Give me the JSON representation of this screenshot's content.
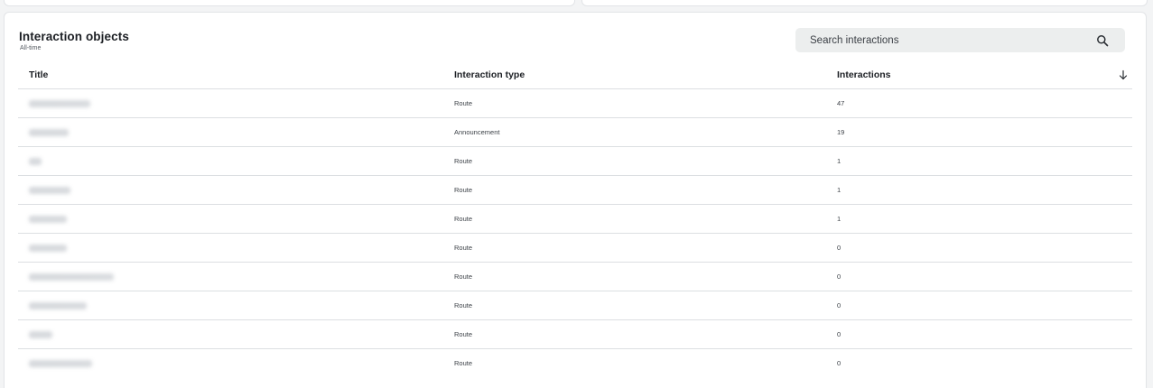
{
  "panel": {
    "title": "Interaction objects",
    "subtitle": "All-time"
  },
  "search": {
    "placeholder": "Search interactions",
    "icon": "search-icon"
  },
  "table": {
    "columns": [
      "Title",
      "Interaction type",
      "Interactions"
    ],
    "sort_icon": "arrow-down-icon",
    "rows": [
      {
        "type": "Route",
        "count": "47"
      },
      {
        "type": "Announcement",
        "count": "19"
      },
      {
        "type": "Route",
        "count": "1"
      },
      {
        "type": "Route",
        "count": "1"
      },
      {
        "type": "Route",
        "count": "1"
      },
      {
        "type": "Route",
        "count": "0"
      },
      {
        "type": "Route",
        "count": "0"
      },
      {
        "type": "Route",
        "count": "0"
      },
      {
        "type": "Route",
        "count": "0"
      },
      {
        "type": "Route",
        "count": "0"
      }
    ]
  }
}
